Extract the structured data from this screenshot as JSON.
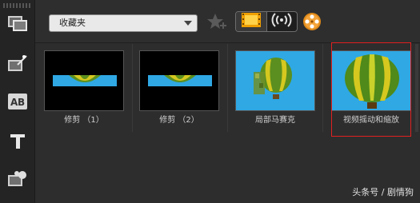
{
  "toolbar": {
    "dropdown_value": "收藏夹"
  },
  "icons": {
    "left": [
      "film-strip-icon",
      "magic-wand-icon",
      "title-ab-icon",
      "text-t-icon",
      "puzzle-icon"
    ],
    "top": [
      "star-add-icon",
      "video-filter-icon",
      "audio-filter-icon",
      "film-reel-icon"
    ]
  },
  "items": [
    {
      "label": "修剪 （1）"
    },
    {
      "label": "修剪 （2）"
    },
    {
      "label": "局部马赛克"
    },
    {
      "label": "视频摇动和缩放"
    }
  ],
  "watermark": "头条号 / 剧情狗",
  "colors": {
    "selection": "#e02020",
    "sky": "#2fa8e4",
    "active_filter": "#f0a000"
  }
}
